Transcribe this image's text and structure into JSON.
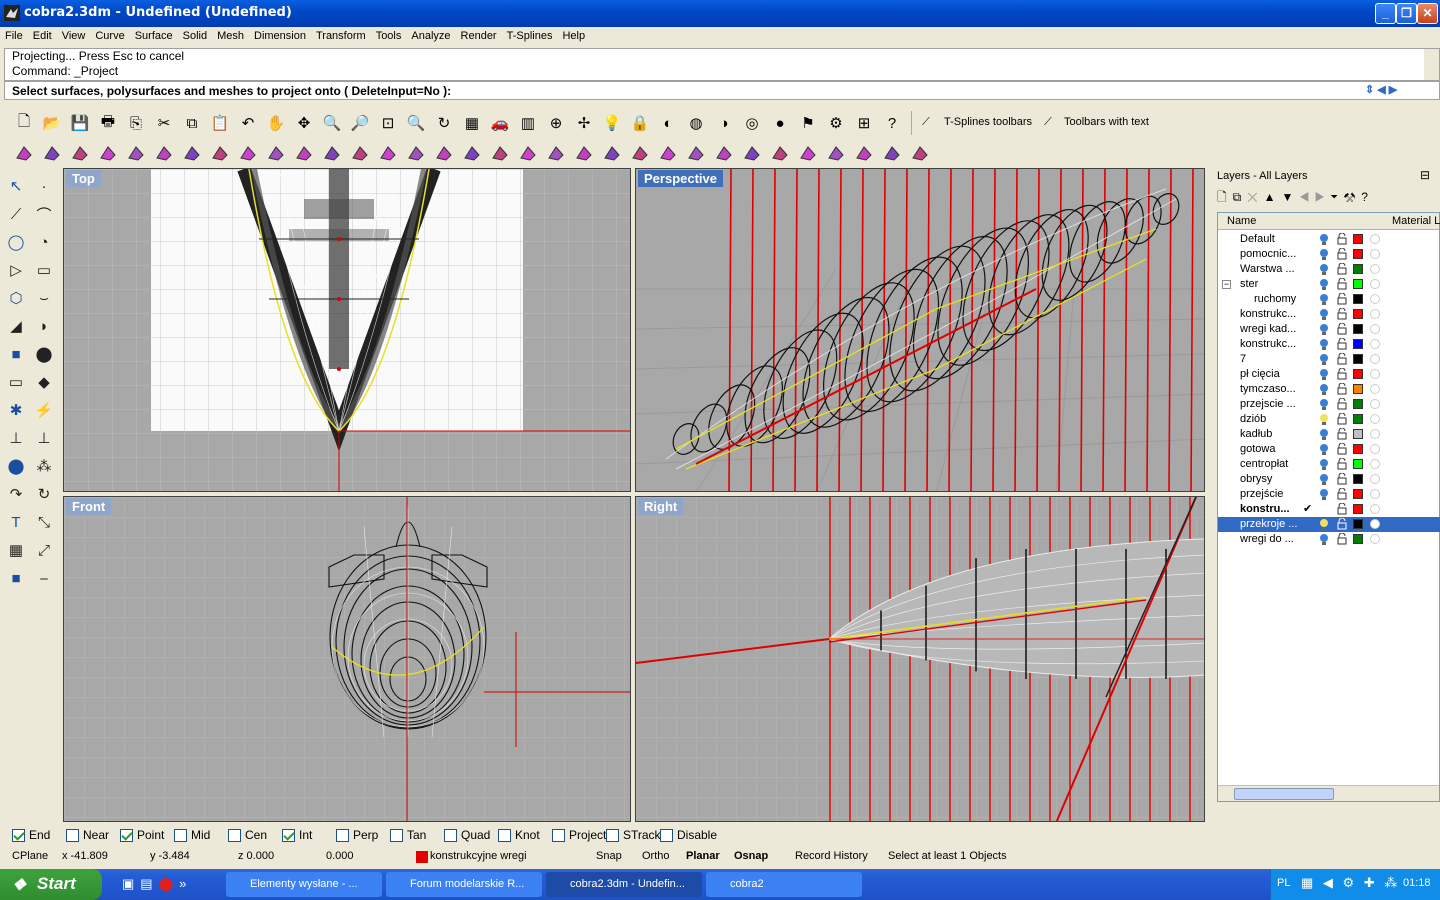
{
  "window": {
    "title": "cobra2.3dm - Undefined (Undefined)",
    "min_label": "_",
    "max_label": "❐",
    "close_label": "✕"
  },
  "menu": [
    "File",
    "Edit",
    "View",
    "Curve",
    "Surface",
    "Solid",
    "Mesh",
    "Dimension",
    "Transform",
    "Tools",
    "Analyze",
    "Render",
    "T-Splines",
    "Help"
  ],
  "command": {
    "history": [
      "Projecting... Press Esc to cancel",
      "Command: _Project"
    ],
    "prompt": "Select surfaces, polysurfaces and meshes to project onto ( DeleteInput=No ):"
  },
  "toolbars": {
    "tsplines_label": "T-Splines toolbars",
    "text_label": "Toolbars with text"
  },
  "viewports": {
    "top": "Top",
    "perspective": "Perspective",
    "front": "Front",
    "right": "Right"
  },
  "layers": {
    "title": "Layers - All Layers",
    "col_name": "Name",
    "col_material": "Material Li",
    "items": [
      {
        "name": "Default",
        "color": "#ff0000",
        "indent": 0,
        "bulb": "#3a7fd5"
      },
      {
        "name": "pomocnic...",
        "color": "#ff0000",
        "indent": 0,
        "bulb": "#3a7fd5"
      },
      {
        "name": "Warstwa ...",
        "color": "#008000",
        "indent": 0,
        "bulb": "#3a7fd5"
      },
      {
        "name": "ster",
        "color": "#00ff00",
        "indent": 0,
        "bulb": "#3a7fd5",
        "expander": "−"
      },
      {
        "name": "ruchomy",
        "color": "#000000",
        "indent": 1,
        "bulb": "#3a7fd5"
      },
      {
        "name": "konstrukc...",
        "color": "#ff0000",
        "indent": 0,
        "bulb": "#3a7fd5"
      },
      {
        "name": "wregi kad...",
        "color": "#000000",
        "indent": 0,
        "bulb": "#3a7fd5"
      },
      {
        "name": "konstrukc...",
        "color": "#0000ff",
        "indent": 0,
        "bulb": "#3a7fd5"
      },
      {
        "name": "7",
        "color": "#000000",
        "indent": 0,
        "bulb": "#3a7fd5"
      },
      {
        "name": "pł cięcia",
        "color": "#ff0000",
        "indent": 0,
        "bulb": "#3a7fd5"
      },
      {
        "name": "tymczaso...",
        "color": "#ff8000",
        "indent": 0,
        "bulb": "#3a7fd5"
      },
      {
        "name": "przejscie ...",
        "color": "#008000",
        "indent": 0,
        "bulb": "#3a7fd5"
      },
      {
        "name": "dziób",
        "color": "#008000",
        "indent": 0,
        "bulb": "#f0e060"
      },
      {
        "name": "kadłub",
        "color": "#c0c0c0",
        "indent": 0,
        "bulb": "#3a7fd5"
      },
      {
        "name": "gotowa",
        "color": "#ff0000",
        "indent": 0,
        "bulb": "#3a7fd5"
      },
      {
        "name": "centropłat",
        "color": "#00ff00",
        "indent": 0,
        "bulb": "#3a7fd5"
      },
      {
        "name": "obrysy",
        "color": "#000000",
        "indent": 0,
        "bulb": "#3a7fd5"
      },
      {
        "name": "przejście",
        "color": "#ff0000",
        "indent": 0,
        "bulb": "#3a7fd5"
      },
      {
        "name": "konstru...",
        "color": "#ff0000",
        "indent": 0,
        "bulb": "",
        "current": "✔",
        "bold": true
      },
      {
        "name": "przekroje ...",
        "color": "#000000",
        "indent": 0,
        "bulb": "#f0e060",
        "selected": true
      },
      {
        "name": "wregi do ...",
        "color": "#008000",
        "indent": 0,
        "bulb": "#3a7fd5"
      }
    ]
  },
  "osnap": [
    {
      "label": "End",
      "checked": true
    },
    {
      "label": "Near",
      "checked": false
    },
    {
      "label": "Point",
      "checked": true
    },
    {
      "label": "Mid",
      "checked": false
    },
    {
      "label": "Cen",
      "checked": false
    },
    {
      "label": "Int",
      "checked": true
    },
    {
      "label": "Perp",
      "checked": false
    },
    {
      "label": "Tan",
      "checked": false
    },
    {
      "label": "Quad",
      "checked": false
    },
    {
      "label": "Knot",
      "checked": false
    },
    {
      "label": "Project",
      "checked": false
    },
    {
      "label": "STrack",
      "checked": false
    },
    {
      "label": "Disable",
      "checked": false
    }
  ],
  "status": {
    "cplane": "CPlane",
    "x": "x -41.809",
    "y": "y -3.484",
    "z": "z 0.000",
    "d": "0.000",
    "layer": "konstrukcyjne wregi",
    "layer_color": "#e00000",
    "snap": "Snap",
    "ortho": "Ortho",
    "planar": "Planar",
    "osnap": "Osnap",
    "record": "Record History",
    "message": "Select at least 1 Objects"
  },
  "taskbar": {
    "start": "Start",
    "tasks": [
      "Elementy wysłane - ...",
      "Forum modelarskie R...",
      "cobra2.3dm - Undefin...",
      "cobra2"
    ],
    "lang": "PL",
    "clock": "01:18"
  }
}
